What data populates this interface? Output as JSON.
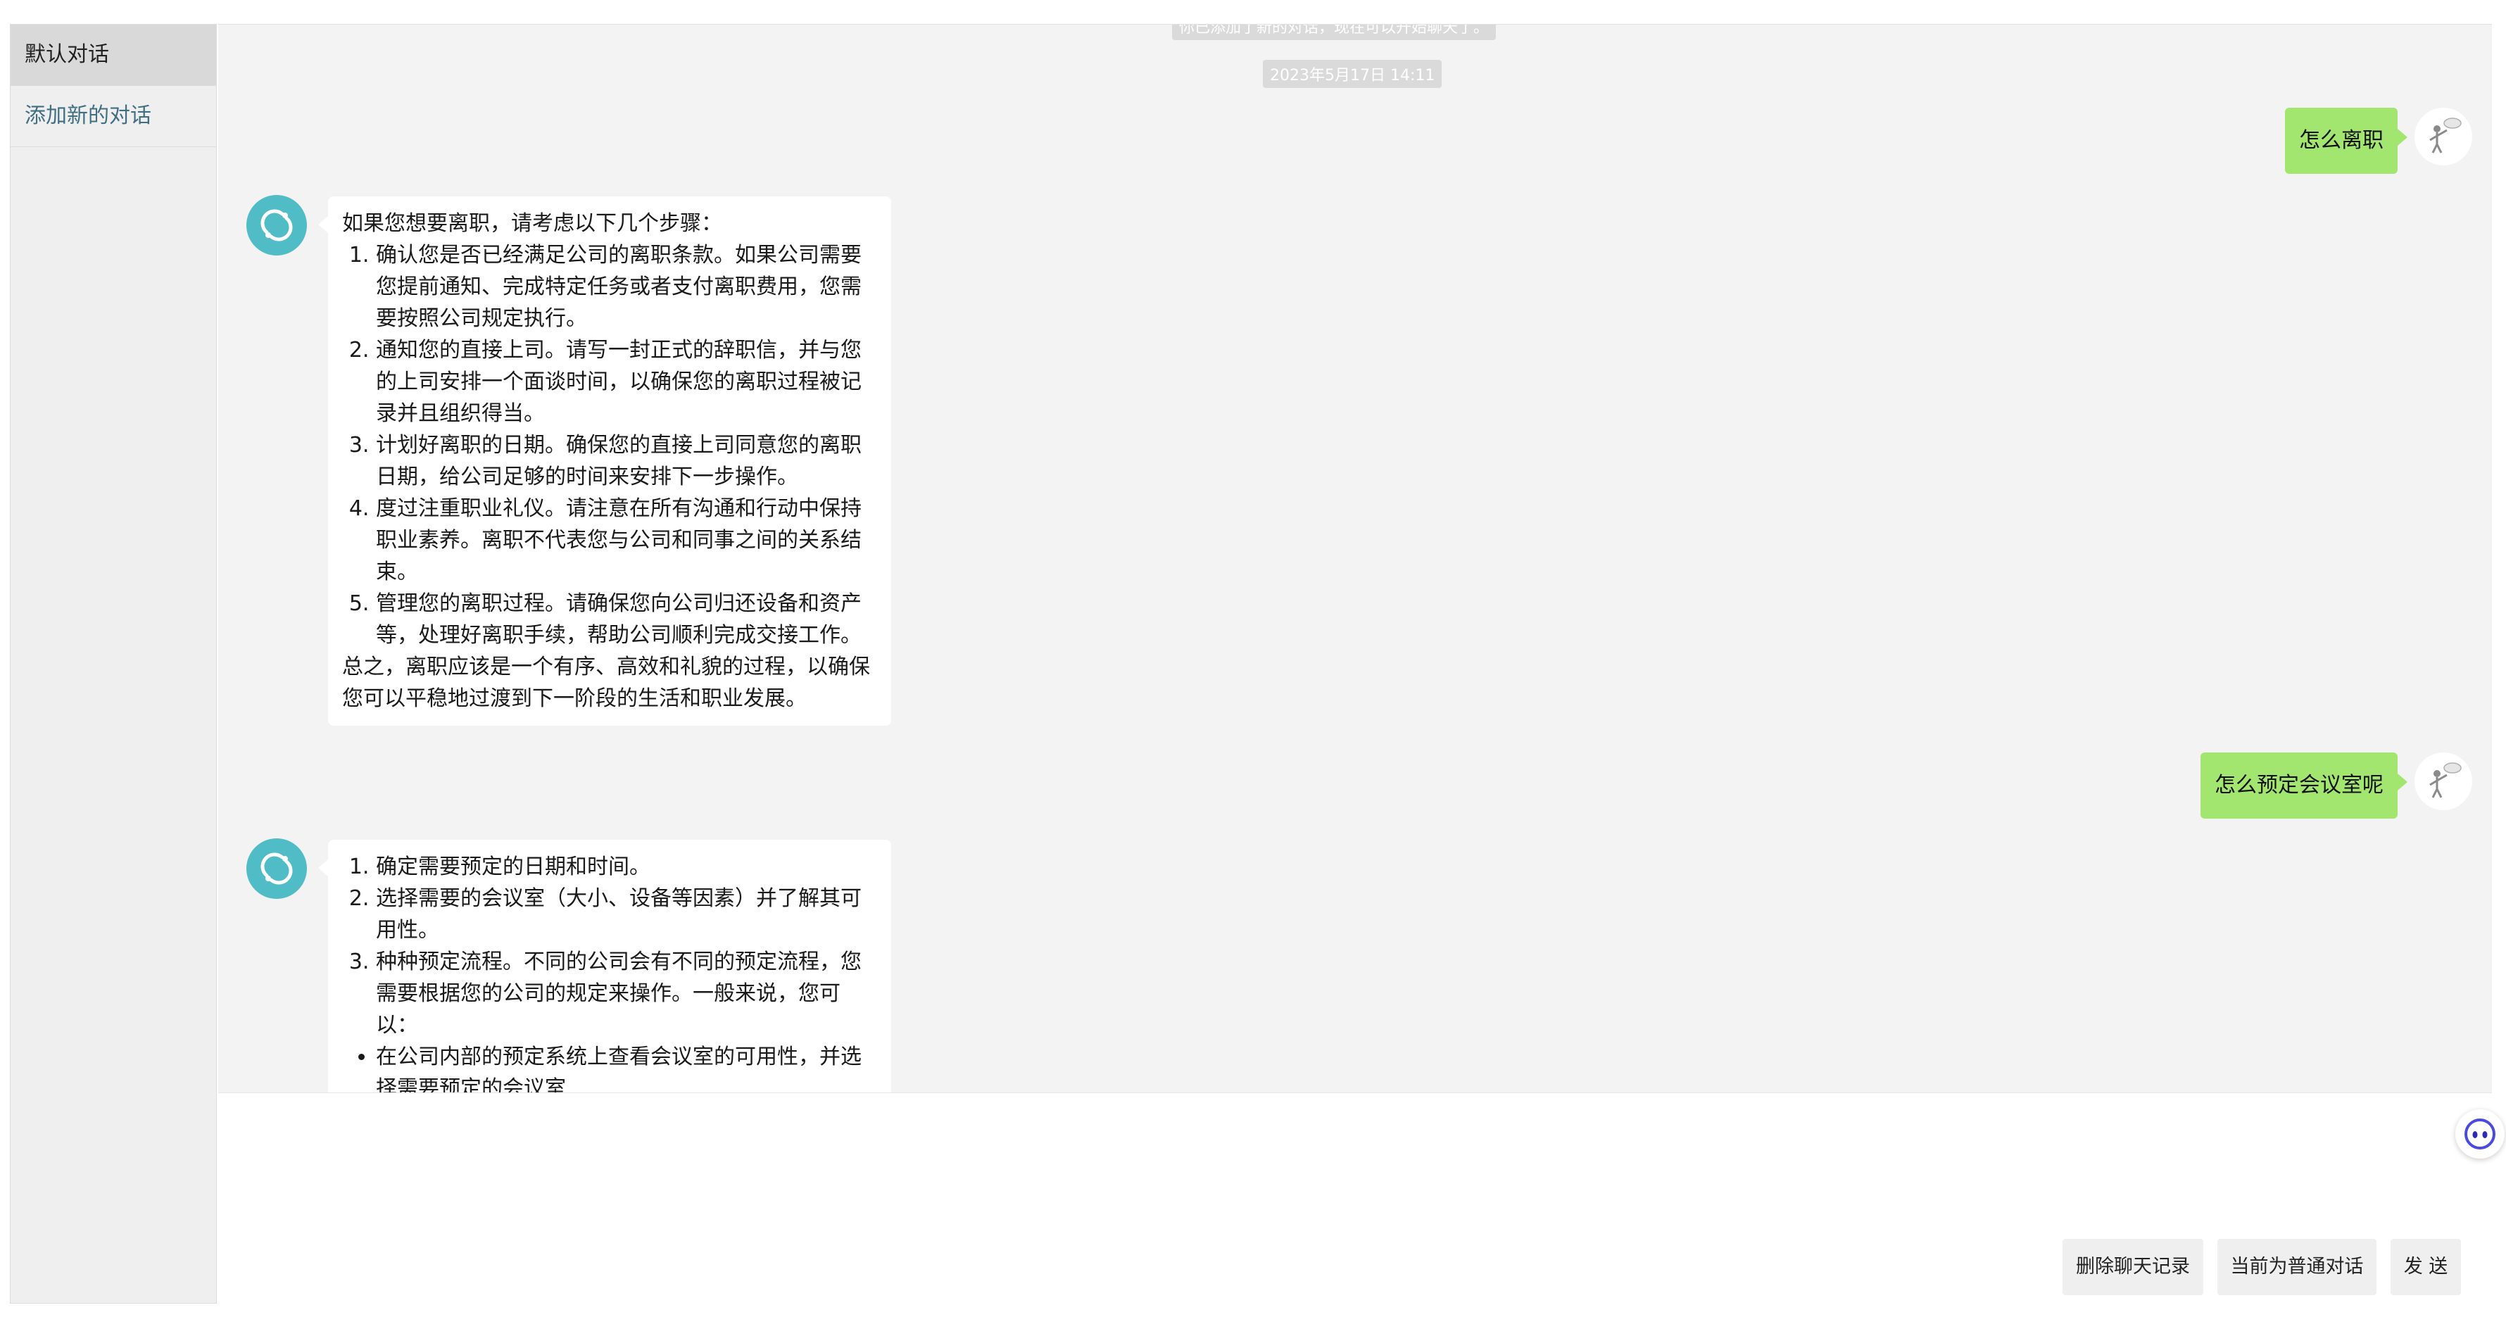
{
  "sidebar": {
    "items": [
      {
        "label": "默认对话"
      },
      {
        "label": "添加新的对话"
      }
    ]
  },
  "chat": {
    "system_notice": "你已添加了新的对话，现在可以开始聊天了。",
    "timestamp": "2023年5月17日 14:11",
    "messages": [
      {
        "role": "user",
        "text": "怎么离职"
      },
      {
        "role": "bot",
        "intro": "如果您想要离职，请考虑以下几个步骤：",
        "steps": [
          "确认您是否已经满足公司的离职条款。如果公司需要您提前通知、完成特定任务或者支付离职费用，您需要按照公司规定执行。",
          "通知您的直接上司。请写一封正式的辞职信，并与您的上司安排一个面谈时间，以确保您的离职过程被记录并且组织得当。",
          "计划好离职的日期。确保您的直接上司同意您的离职日期，给公司足够的时间来安排下一步操作。",
          "度过注重职业礼仪。请注意在所有沟通和行动中保持职业素养。离职不代表您与公司和同事之间的关系结束。",
          "管理您的离职过程。请确保您向公司归还设备和资产等，处理好离职手续，帮助公司顺利完成交接工作。"
        ],
        "outro": "总之，离职应该是一个有序、高效和礼貌的过程，以确保您可以平稳地过渡到下一阶段的生活和职业发展。"
      },
      {
        "role": "user",
        "text": "怎么预定会议室呢"
      },
      {
        "role": "bot",
        "steps": [
          "确定需要预定的日期和时间。",
          "选择需要的会议室（大小、设备等因素）并了解其可用性。",
          "种种预定流程。不同的公司会有不同的预定流程，您需要根据您的公司的规定来操作。一般来说，您可以："
        ],
        "bullets": [
          "在公司内部的预定系统上查看会议室的可用性，并选择需要预定的会议室"
        ]
      }
    ]
  },
  "input": {
    "value": "",
    "buttons": {
      "clear": "删除聊天记录",
      "mode": "当前为普通对话",
      "send": "发 送"
    }
  },
  "colors": {
    "user_bubble": "#a2e66f",
    "bot_avatar": "#4fbcc6",
    "chat_background": "#f3f3f3"
  },
  "icons": {
    "user_avatar": "stick-figure-avatar-icon",
    "bot_avatar": "chat-logo-icon",
    "floater": "robot-face-icon"
  }
}
